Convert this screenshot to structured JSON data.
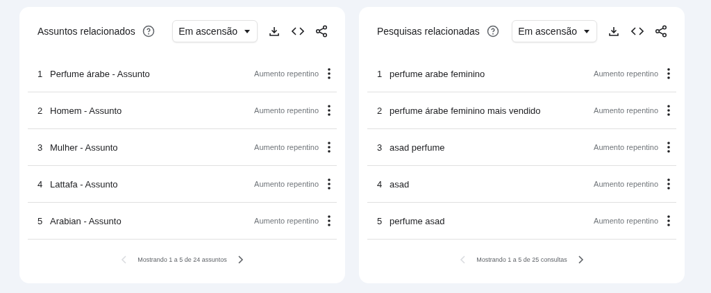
{
  "panels": [
    {
      "title": "Assuntos relacionados",
      "dropdown": "Em ascensão",
      "rows": [
        {
          "rank": "1",
          "label": "Perfume árabe - Assunto",
          "value": "Aumento repentino"
        },
        {
          "rank": "2",
          "label": "Homem - Assunto",
          "value": "Aumento repentino"
        },
        {
          "rank": "3",
          "label": "Mulher - Assunto",
          "value": "Aumento repentino"
        },
        {
          "rank": "4",
          "label": "Lattafa - Assunto",
          "value": "Aumento repentino"
        },
        {
          "rank": "5",
          "label": "Arabian - Assunto",
          "value": "Aumento repentino"
        }
      ],
      "pagination": {
        "text": "Mostrando 1 a 5 de 24 assuntos",
        "prev_disabled": true,
        "next_disabled": false
      }
    },
    {
      "title": "Pesquisas relacionadas",
      "dropdown": "Em ascensão",
      "rows": [
        {
          "rank": "1",
          "label": "perfume arabe feminino",
          "value": "Aumento repentino"
        },
        {
          "rank": "2",
          "label": "perfume árabe feminino mais vendido",
          "value": "Aumento repentino"
        },
        {
          "rank": "3",
          "label": "asad perfume",
          "value": "Aumento repentino"
        },
        {
          "rank": "4",
          "label": "asad",
          "value": "Aumento repentino"
        },
        {
          "rank": "5",
          "label": "perfume asad",
          "value": "Aumento repentino"
        }
      ],
      "pagination": {
        "text": "Mostrando 1 a 5 de 25 consultas",
        "prev_disabled": true,
        "next_disabled": false
      }
    }
  ]
}
